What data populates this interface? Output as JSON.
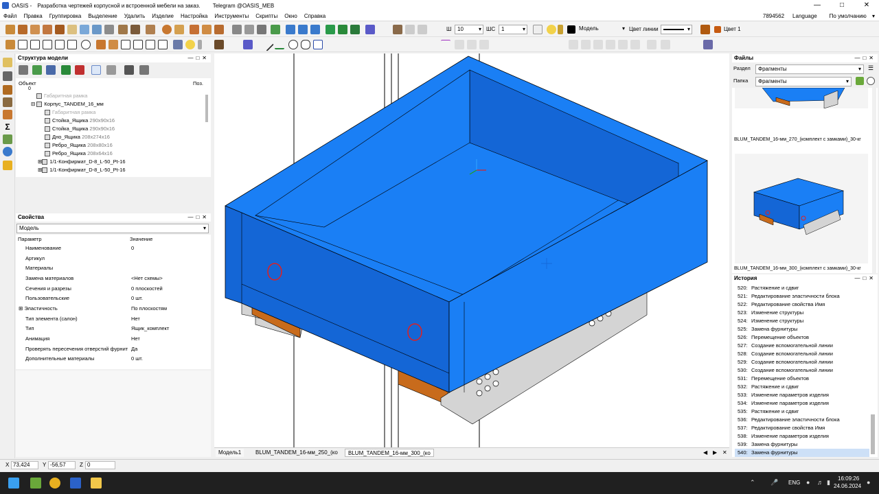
{
  "window": {
    "app_name": "OASIS -",
    "title": "Разработка чертежей корпусной и встроенной мебели на заказ",
    "title_suffix": ".",
    "telegram": "Telegram  @OASIS_MEB"
  },
  "menu": {
    "items": [
      "Файл",
      "Правка",
      "Группировка",
      "Выделение",
      "Удалить",
      "Изделие",
      "Настройка",
      "Инструменты",
      "Скрипты",
      "Окно",
      "Справка"
    ],
    "user_id": "7894562",
    "language": "Language",
    "profile": "По умолчанию"
  },
  "toolbar": {
    "line_width_label": "Ш",
    "line_width_value": "10",
    "line_style_label": "ШС",
    "line_style_value": "1",
    "layer_value": "Модель",
    "line_color_label": "Цвет линии",
    "color_label": "Цвет 1",
    "accent": "#ff8c00"
  },
  "structure_panel": {
    "title": "Структура модели",
    "col_object": "Объект",
    "col_pos": "Поз.",
    "tree": [
      {
        "label": "0",
        "size": "",
        "muted": false
      },
      {
        "label": "Габаритная рамка",
        "size": "",
        "muted": true
      },
      {
        "label": "Корпус_TANDEM_16_мм",
        "size": "",
        "muted": false
      },
      {
        "label": "Габаритная рамка",
        "size": "",
        "muted": true
      },
      {
        "label": "Стойка_Ящика",
        "size": "290x90x16",
        "muted": false
      },
      {
        "label": "Стойка_Ящика",
        "size": "290x90x16",
        "muted": false
      },
      {
        "label": "Дно_Ящика",
        "size": "208x274x16",
        "muted": false
      },
      {
        "label": "Ребро_Ящика",
        "size": "208x80x16",
        "muted": false
      },
      {
        "label": "Ребро_Ящика",
        "size": "208x64x16",
        "muted": false
      },
      {
        "label": "1/1-Конфирмат_D-8_L-50_Pt-16",
        "size": "",
        "muted": false
      },
      {
        "label": "1/1-Конфирмат_D-8_L-50_Pt-16",
        "size": "",
        "muted": false
      }
    ]
  },
  "properties_panel": {
    "title": "Свойства",
    "selector": "Модель",
    "col_param": "Параметр",
    "col_value": "Значение",
    "rows": [
      {
        "param": "Наименование",
        "value": "0"
      },
      {
        "param": "Артикул",
        "value": ""
      },
      {
        "param": "Материалы",
        "value": ""
      },
      {
        "param": "Замена материалов",
        "value": "<Нет схемы>"
      },
      {
        "param": "Сечения и разрезы",
        "value": "0 плоскостей"
      },
      {
        "param": "Пользовательские",
        "value": "0 шт."
      },
      {
        "param": "Эластичность",
        "value": "По плоскостям"
      },
      {
        "param": "Тип элемента (салон)",
        "value": "Нет"
      },
      {
        "param": "Тип",
        "value": "Ящик_комплект"
      },
      {
        "param": "Анимация",
        "value": "Нет"
      },
      {
        "param": "Проверять пересечения отверстий фурнит",
        "value": "Да"
      },
      {
        "param": "Дополнительные материалы",
        "value": "0 шт."
      }
    ]
  },
  "files_panel": {
    "title": "Файлы",
    "section_label": "Раздел",
    "section_value": "Фрагменты",
    "folder_label": "Папка",
    "folder_value": "Фрагменты",
    "items": [
      "BLUM_TANDEM_16-мм_270_(комплект с замками)_30-кг",
      "BLUM_TANDEM_16-мм_300_(комплект с замками)_30-кг"
    ]
  },
  "history_panel": {
    "title": "История",
    "items": [
      {
        "num": "520:",
        "text": "Растяжение и сдвиг"
      },
      {
        "num": "521:",
        "text": "Редактирование эластичности блока"
      },
      {
        "num": "522:",
        "text": "Редактирование свойства Имя"
      },
      {
        "num": "523:",
        "text": "Изменение структуры"
      },
      {
        "num": "524:",
        "text": "Изменение структуры"
      },
      {
        "num": "525:",
        "text": "Замена фурнитуры"
      },
      {
        "num": "526:",
        "text": "Перемещение объектов"
      },
      {
        "num": "527:",
        "text": "Создание вспомогательной линии"
      },
      {
        "num": "528:",
        "text": "Создание вспомогательной линии"
      },
      {
        "num": "529:",
        "text": "Создание вспомогательной линии"
      },
      {
        "num": "530:",
        "text": "Создание вспомогательной линии"
      },
      {
        "num": "531:",
        "text": "Перемещение объектов"
      },
      {
        "num": "532:",
        "text": "Растяжение и сдвиг"
      },
      {
        "num": "533:",
        "text": "Изменение параметров изделия"
      },
      {
        "num": "534:",
        "text": "Изменение параметров изделия"
      },
      {
        "num": "535:",
        "text": "Растяжение и сдвиг"
      },
      {
        "num": "536:",
        "text": "Редактирование эластичности блока"
      },
      {
        "num": "537:",
        "text": "Редактирование свойства Имя"
      },
      {
        "num": "538:",
        "text": "Изменение параметров изделия"
      },
      {
        "num": "539:",
        "text": "Замена фурнитуры"
      },
      {
        "num": "540:",
        "text": "Замена фурнитуры"
      }
    ]
  },
  "tabs": {
    "items": [
      "Модель1",
      "BLUM_TANDEM_16-мм_250_(ко",
      "BLUM_TANDEM_16-мм_300_(ко"
    ]
  },
  "status": {
    "x_label": "X",
    "x_value": "73,424",
    "y_label": "Y",
    "y_value": "-56,57",
    "z_label": "Z",
    "z_value": "0"
  },
  "taskbar": {
    "lang": "ENG",
    "time": "16:09:26",
    "date": "24.06.2024"
  },
  "colors": {
    "drawer_blue": "#1a7ff5",
    "drawer_dark": "#1466d6",
    "runner_orange": "#c86b1c",
    "runner_gray": "#d4d4d4"
  }
}
